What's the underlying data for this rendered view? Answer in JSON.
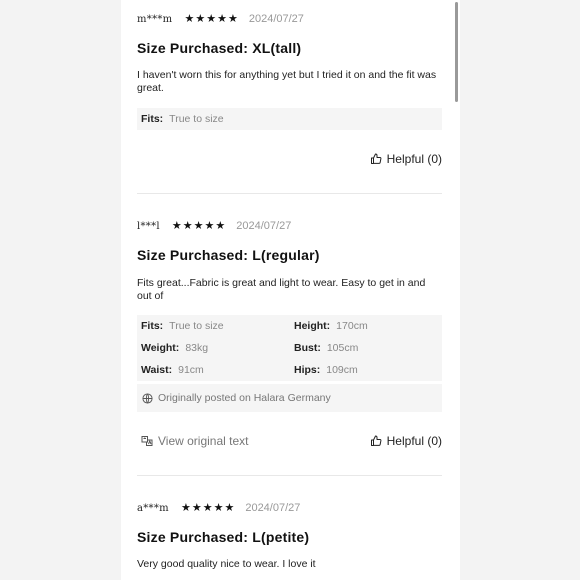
{
  "reviews": [
    {
      "user": "m***m",
      "rating": 5,
      "date": "2024/07/27",
      "title": "Size Purchased: XL(tall)",
      "body": "I haven't worn this for anything yet but I tried it on and the fit was great.",
      "specs": [
        {
          "key": "Fits:",
          "value": "True to size"
        }
      ],
      "helpful": "Helpful (0)"
    },
    {
      "user": "l***l",
      "rating": 5,
      "date": "2024/07/27",
      "title": "Size Purchased: L(regular)",
      "body": "Fits great...Fabric is great and light to wear. Easy to get in and out of",
      "specs": [
        {
          "key": "Fits:",
          "value": "True to size"
        },
        {
          "key": "Height:",
          "value": "170cm"
        },
        {
          "key": "Weight:",
          "value": "83kg"
        },
        {
          "key": "Bust:",
          "value": "105cm"
        },
        {
          "key": "Waist:",
          "value": "91cm"
        },
        {
          "key": "Hips:",
          "value": "109cm"
        }
      ],
      "origin": "Originally posted on Halara Germany",
      "view_original": "View original text",
      "helpful": "Helpful (0)"
    },
    {
      "user": "a***m",
      "rating": 5,
      "date": "2024/07/27",
      "title": "Size Purchased: L(petite)",
      "body": "Very good quality nice to wear. I love it"
    }
  ],
  "icons": {
    "star": "star-icon",
    "thumb": "thumbs-up-icon",
    "globe": "globe-icon",
    "translate": "translate-icon"
  }
}
